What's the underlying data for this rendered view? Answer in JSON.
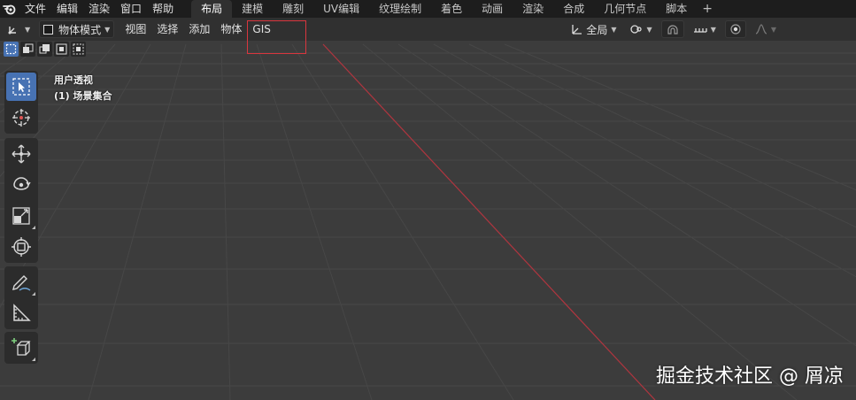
{
  "menubar": {
    "file": "文件",
    "edit": "编辑",
    "render": "渲染",
    "window": "窗口",
    "help": "帮助"
  },
  "workspace_tabs": [
    {
      "label": "布局",
      "active": true
    },
    {
      "label": "建模",
      "active": false
    },
    {
      "label": "雕刻",
      "active": false
    },
    {
      "label": "UV编辑",
      "active": false
    },
    {
      "label": "纹理绘制",
      "active": false
    },
    {
      "label": "着色",
      "active": false
    },
    {
      "label": "动画",
      "active": false
    },
    {
      "label": "渲染",
      "active": false
    },
    {
      "label": "合成",
      "active": false
    },
    {
      "label": "几何节点",
      "active": false
    },
    {
      "label": "脚本",
      "active": false
    }
  ],
  "add_workspace": "+",
  "header": {
    "mode": "物体模式",
    "view": "视图",
    "select": "选择",
    "add": "添加",
    "object": "物体",
    "gis": "GIS",
    "transform_orientation": "全局"
  },
  "viewport": {
    "perspective": "用户透视",
    "collection": "(1) 场景集合"
  },
  "watermark": "掘金技术社区 @ 屑凉",
  "colors": {
    "accent": "#4772b3",
    "highlight_box": "#d9363e",
    "x_axis": "#b0353f"
  }
}
